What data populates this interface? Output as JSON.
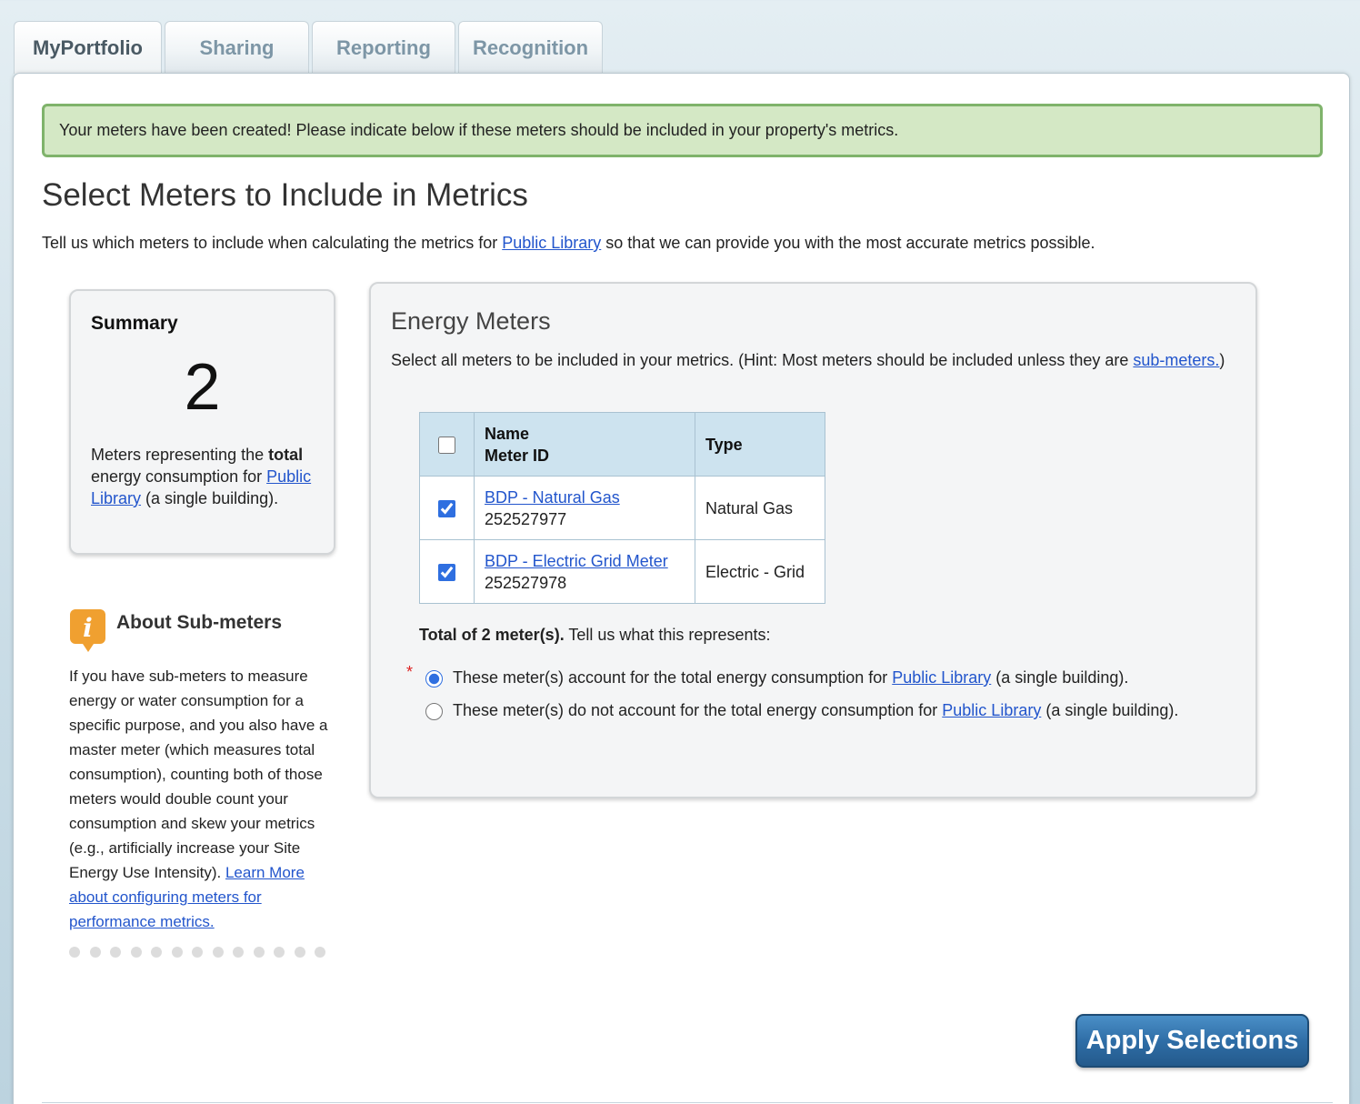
{
  "tabs": [
    {
      "label": "MyPortfolio",
      "active": true
    },
    {
      "label": "Sharing",
      "active": false
    },
    {
      "label": "Reporting",
      "active": false
    },
    {
      "label": "Recognition",
      "active": false
    }
  ],
  "alert": {
    "text": "Your meters have been created! Please indicate below if these meters should be included in your property's metrics."
  },
  "page": {
    "title": "Select Meters to Include in Metrics",
    "intro_before": "Tell us which meters to include when calculating the metrics for ",
    "intro_link": "Public Library",
    "intro_after": " so that we can provide you with the most accurate metrics possible."
  },
  "summary": {
    "title": "Summary",
    "count": "2",
    "desc_1": "Meters representing the ",
    "desc_bold": "total",
    "desc_2": " energy consumption for ",
    "desc_link": "Public Library",
    "desc_3": " (a single building)."
  },
  "about": {
    "title": "About Sub-meters",
    "text": "If you have sub-meters to measure energy or water consumption for a specific purpose, and you also have a master meter (which measures total consumption), counting both of those meters would double count your consumption and skew your metrics (e.g., artificially increase your Site Energy Use Intensity). ",
    "link": "Learn More about configuring meters for performance metrics.",
    "dot_count": 13
  },
  "energy": {
    "title": "Energy Meters",
    "hint_before": "Select all meters to be included in your metrics. (Hint: Most meters should be included unless they are ",
    "hint_link": "sub-meters.",
    "hint_after": ")",
    "table": {
      "header_name": "Name",
      "header_meter_id": "Meter ID",
      "header_type": "Type",
      "select_all_checked": false,
      "rows": [
        {
          "name": "BDP - Natural Gas",
          "meter_id": "252527977",
          "type": "Natural Gas",
          "checked": true
        },
        {
          "name": "BDP - Electric Grid Meter",
          "meter_id": "252527978",
          "type": "Electric - Grid",
          "checked": true
        }
      ]
    },
    "total_bold": "Total of 2 meter(s).",
    "total_rest": " Tell us what this represents:",
    "required_mark": "*",
    "option_1_before": "These meter(s) account for the total energy consumption for ",
    "option_1_link": "Public Library",
    "option_1_after": " (a single building).",
    "option_2_before": "These meter(s) do not account for the total energy consumption for ",
    "option_2_link": "Public Library",
    "option_2_after": " (a single building).",
    "selected_option": 1
  },
  "apply_button": {
    "label": "Apply Selections"
  },
  "colors": {
    "accent": "#2f6ea7",
    "alert_bg": "#d4e8c5",
    "alert_border": "#7fb36b",
    "link": "#2255cc",
    "info_icon": "#f0a030"
  }
}
